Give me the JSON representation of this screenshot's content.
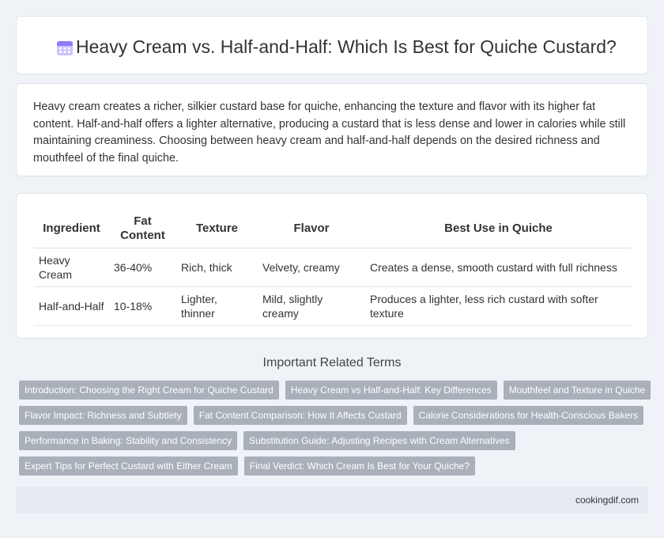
{
  "header": {
    "title": "Heavy Cream vs. Half-and-Half: Which Is Best for Quiche Custard?",
    "icon": "calendar-icon"
  },
  "intro": {
    "text": "Heavy cream creates a richer, silkier custard base for quiche, enhancing the texture and flavor with its higher fat content. Half-and-half offers a lighter alternative, producing a custard that is less dense and lower in calories while still maintaining creaminess. Choosing between heavy cream and half-and-half depends on the desired richness and mouthfeel of the final quiche."
  },
  "table": {
    "headers": [
      "Ingredient",
      "Fat Content",
      "Texture",
      "Flavor",
      "Best Use in Quiche"
    ],
    "rows": [
      [
        "Heavy Cream",
        "36-40%",
        "Rich, thick",
        "Velvety, creamy",
        "Creates a dense, smooth custard with full richness"
      ],
      [
        "Half-and-Half",
        "10-18%",
        "Lighter, thinner",
        "Mild, slightly creamy",
        "Produces a lighter, less rich custard with softer texture"
      ]
    ]
  },
  "related": {
    "title": "Important Related Terms",
    "rows": [
      [
        "Introduction: Choosing the Right Cream for Quiche Custard",
        "Heavy Cream vs Half-and-Half: Key Differences",
        "Mouthfeel and Texture in Quiche"
      ],
      [
        "Flavor Impact: Richness and Subtlety",
        "Fat Content Comparison: How It Affects Custard",
        "Calorie Considerations for Health-Conscious Bakers"
      ],
      [
        "Performance in Baking: Stability and Consistency",
        "Substitution Guide: Adjusting Recipes with Cream Alternatives"
      ],
      [
        "Expert Tips for Perfect Custard with Either Cream",
        "Final Verdict: Which Cream Is Best for Your Quiche?"
      ]
    ]
  },
  "footer": {
    "site": "cookingdif.com"
  },
  "colors": {
    "background": "#eff2f7",
    "tag": "#a9b0ba",
    "icon_accent": "#8b7cf6"
  }
}
